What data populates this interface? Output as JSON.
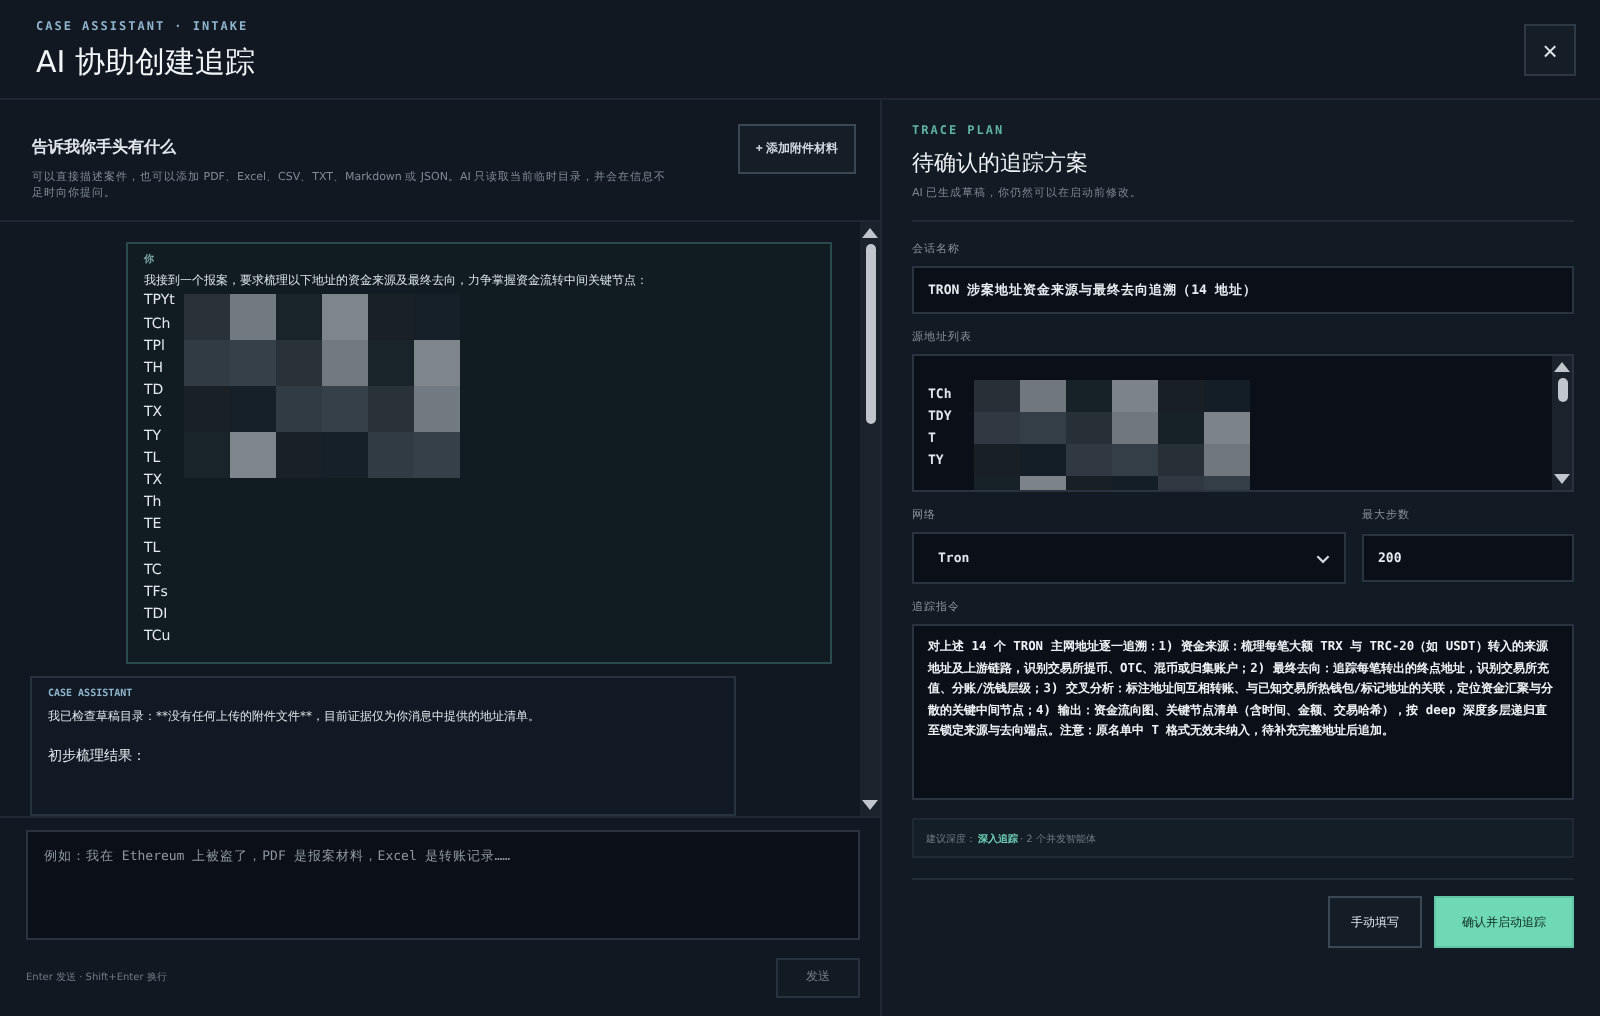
{
  "header": {
    "eyebrow": "CASE ASSISTANT · INTAKE",
    "title": "AI 协助创建追踪",
    "close": "×"
  },
  "intake": {
    "heading": "告诉我你手头有什么",
    "description": "可以直接描述案件，也可以添加 PDF、Excel、CSV、TXT、Markdown 或 JSON。AI 只读取当前临时目录，并会在信息不足时向你提问。",
    "add_button": "+ 添加附件材料"
  },
  "messages": [
    {
      "kind": "user",
      "author": "你",
      "text": "我接到一个报案，要求梳理以下地址的资金来源及最终去向，力争掌握资金流转中间关键节点：",
      "lines": [
        "TPYt",
        "TCh",
        "TPl",
        "TH",
        "TD",
        "TX",
        "TY",
        "TL",
        "TX",
        "Th",
        "TE",
        "TL",
        "TC",
        "TFs",
        "TDI",
        "TCu"
      ]
    },
    {
      "kind": "assistant",
      "author": "CASE ASSISTANT",
      "text": "我已检查草稿目录：**没有任何上传的附件文件**，目前证据仅为你消息中提供的地址清单。",
      "lines": [
        "初步梳理结果："
      ]
    }
  ],
  "composer": {
    "placeholder": "例如：我在 Ethereum 上被盗了，PDF 是报案材料，Excel 是转账记录……",
    "hint": "Enter 发送 · Shift+Enter 换行",
    "send": "发送",
    "disabled": true
  },
  "plan": {
    "eyebrow": "TRACE PLAN",
    "title": "待确认的追踪方案",
    "subtitle": "AI 已生成草稿，你仍然可以在启动前修改。",
    "session_label": "会话名称",
    "session_value": "TRON 涉案地址资金来源与最终去向追溯（14 地址）",
    "addresses_label": "源地址列表",
    "addresses": [
      "TCh",
      "TDY",
      "T",
      "TY"
    ],
    "network_label": "网络",
    "network_value": "Tron",
    "steps_label": "最大步数",
    "steps_value": "200",
    "instruction_label": "追踪指令",
    "instruction_value": "对上述 14 个 TRON 主网地址逐一追溯：1) 资金来源：梳理每笔大额 TRX 与 TRC-20（如 USDT）转入的来源地址及上游链路，识别交易所提币、OTC、混币或归集账户；2) 最终去向：追踪每笔转出的终点地址，识别交易所充值、分账/洗钱层级；3) 交叉分析：标注地址间互相转账、与已知交易所热钱包/标记地址的关联，定位资金汇聚与分散的关键中间节点；4) 输出：资金流向图、关键节点清单（含时间、金额、交易哈希），按 deep 深度多层递归直至锁定来源与去向端点。注意：原名单中 T 格式无效未纳入，待补充完整地址后追加。",
    "depth_hint": "建议深度：**深入追踪** · 2 个并发智能体",
    "manual_button": "手动填写",
    "confirm_button": "确认并启动追踪"
  }
}
